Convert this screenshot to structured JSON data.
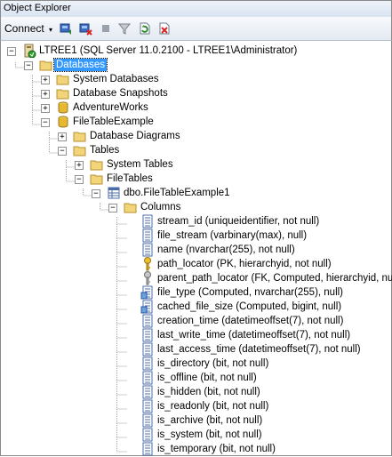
{
  "window": {
    "title": "Object Explorer"
  },
  "toolbar": {
    "connect_label": "Connect",
    "connect_arrow": "▾"
  },
  "tree": {
    "server": "LTREE1 (SQL Server 11.0.2100 - LTREE1\\Administrator)",
    "databases": "Databases",
    "system_databases": "System Databases",
    "database_snapshots": "Database Snapshots",
    "adventureworks": "AdventureWorks",
    "filetableexample": "FileTableExample",
    "database_diagrams": "Database Diagrams",
    "tables": "Tables",
    "system_tables": "System Tables",
    "filetables": "FileTables",
    "table": "dbo.FileTableExample1",
    "columns_folder": "Columns",
    "columns": [
      "stream_id (uniqueidentifier, not null)",
      "file_stream (varbinary(max), null)",
      "name (nvarchar(255), not null)",
      "path_locator (PK, hierarchyid, not null)",
      "parent_path_locator (FK, Computed, hierarchyid, null)",
      "file_type (Computed, nvarchar(255), null)",
      "cached_file_size (Computed, bigint, null)",
      "creation_time (datetimeoffset(7), not null)",
      "last_write_time (datetimeoffset(7), not null)",
      "last_access_time (datetimeoffset(7), not null)",
      "is_directory (bit, not null)",
      "is_offline (bit, not null)",
      "is_hidden (bit, not null)",
      "is_readonly (bit, not null)",
      "is_archive (bit, not null)",
      "is_system (bit, not null)",
      "is_temporary (bit, not null)"
    ]
  }
}
